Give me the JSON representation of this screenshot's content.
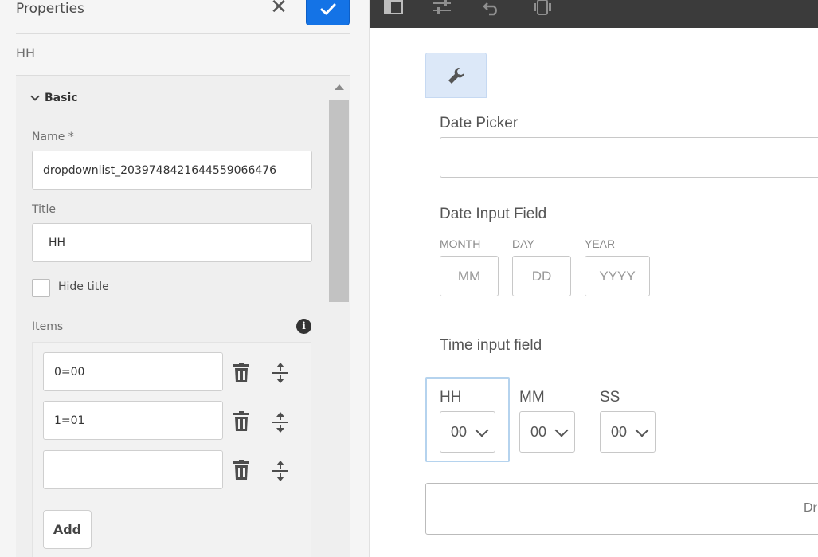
{
  "panel": {
    "title": "Properties",
    "breadcrumb": "HH",
    "section_label": "Basic",
    "name_label": "Name *",
    "name_value": "dropdownlist_2039748421644559066476",
    "title_label": "Title",
    "title_value": "HH",
    "hide_title_label": "Hide title",
    "items_label": "Items",
    "items": [
      {
        "value": "0=00"
      },
      {
        "value": "1=01"
      },
      {
        "value": ""
      }
    ],
    "add_label": "Add"
  },
  "toolbar": {
    "icons": [
      "layout-icon",
      "settings-sliders-icon",
      "undo-icon",
      "device-preview-icon"
    ]
  },
  "canvas": {
    "date_picker_title": "Date Picker",
    "date_input_title": "Date Input Field",
    "month_label": "MONTH",
    "month_placeholder": "MM",
    "day_label": "DAY",
    "day_placeholder": "DD",
    "year_label": "YEAR",
    "year_placeholder": "YYYY",
    "time_title": "Time input field",
    "hh_label": "HH",
    "hh_value": "00",
    "mm_label": "MM",
    "mm_value": "00",
    "ss_label": "SS",
    "ss_value": "00",
    "bottom_partial_text": "Dr"
  },
  "colors": {
    "accent": "#1473e6",
    "toolbar": "#3b3b3b",
    "selection": "#b5d3ee"
  }
}
